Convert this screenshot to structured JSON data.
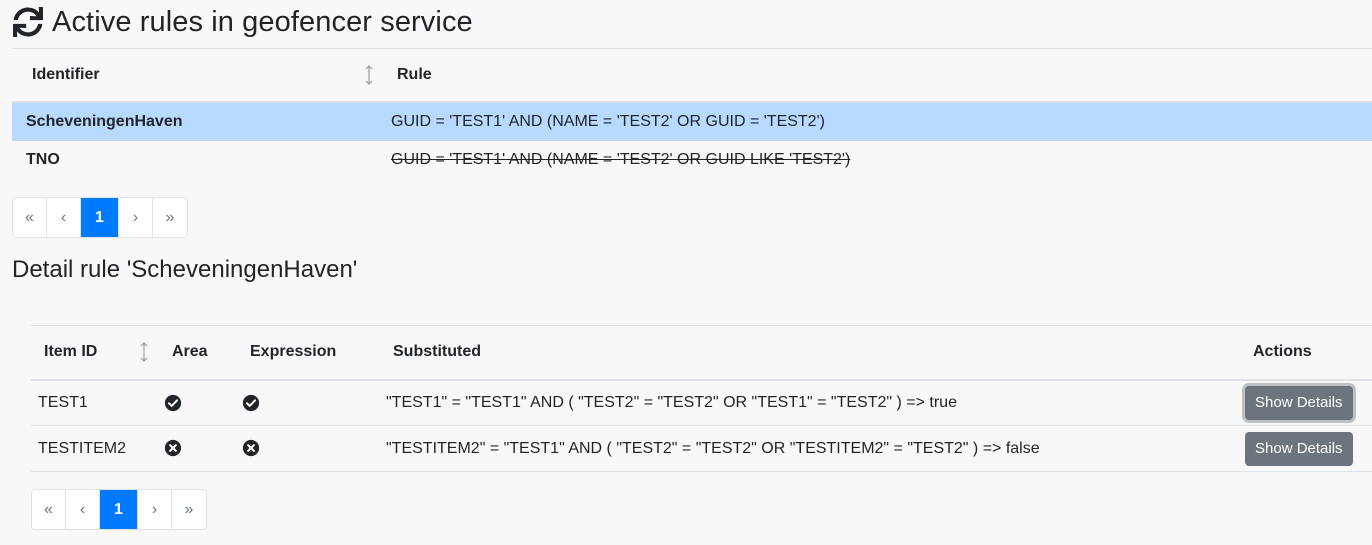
{
  "header": {
    "title": "Active rules in geofencer service",
    "refresh_icon": "refresh-icon"
  },
  "rules_table": {
    "columns": [
      "Identifier",
      "Rule"
    ],
    "rows": [
      {
        "identifier": "ScheveningenHaven",
        "rule": "GUID = 'TEST1' AND (NAME = 'TEST2' OR GUID = 'TEST2')",
        "selected": true,
        "disabled": false
      },
      {
        "identifier": "TNO",
        "rule": "GUID = 'TEST1' AND (NAME = 'TEST2' OR GUID LIKE 'TEST2')",
        "selected": false,
        "disabled": true
      }
    ]
  },
  "pagination_rules": {
    "first": "«",
    "prev": "‹",
    "current": "1",
    "next": "›",
    "last": "»"
  },
  "detail": {
    "title": "Detail rule 'ScheveningenHaven'",
    "columns": [
      "Item ID",
      "Area",
      "Expression",
      "Substituted",
      "Actions"
    ],
    "rows": [
      {
        "item_id": "TEST1",
        "area": "check-circle-icon",
        "expression": "check-circle-icon",
        "substituted": "\"TEST1\" = \"TEST1\" AND ( \"TEST2\" = \"TEST2\" OR \"TEST1\" = \"TEST2\" ) => true",
        "action": "Show Details"
      },
      {
        "item_id": "TESTITEM2",
        "area": "times-circle-icon",
        "expression": "times-circle-icon",
        "substituted": "\"TESTITEM2\" = \"TEST1\" AND ( \"TEST2\" = \"TEST2\" OR \"TESTITEM2\" = \"TEST2\" ) => false",
        "action": "Show Details"
      }
    ]
  },
  "pagination_detail": {
    "first": "«",
    "prev": "‹",
    "current": "1",
    "next": "›",
    "last": "»"
  },
  "colors": {
    "selected_row": "#b8daff",
    "primary": "#007bff",
    "secondary_button": "#6c757d"
  }
}
